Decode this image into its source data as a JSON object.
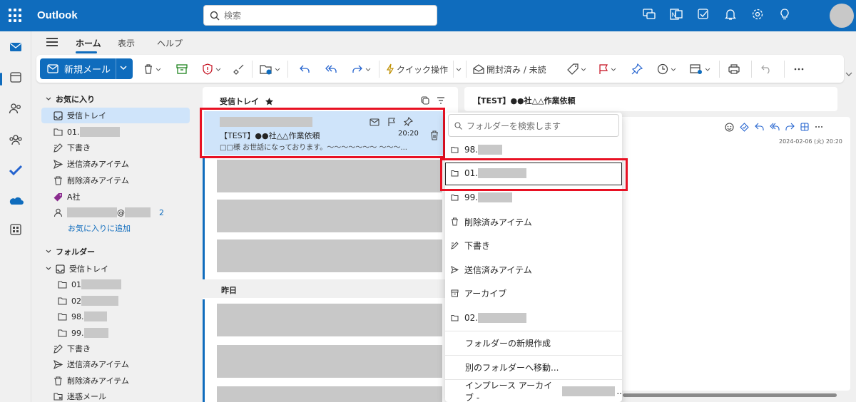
{
  "app": {
    "title": "Outlook"
  },
  "search": {
    "placeholder": "検索"
  },
  "tabs": [
    "ホーム",
    "表示",
    "ヘルプ"
  ],
  "ribbon": {
    "new_mail": "新規メール",
    "quick_steps": "クイック操作",
    "read_unread": "開封済み / 未読"
  },
  "folders": {
    "favorites_header": "お気に入り",
    "favorites": [
      {
        "label": "受信トレイ",
        "icon": "inbox-icon"
      },
      {
        "label": "01.",
        "icon": "folder-icon"
      },
      {
        "label": "下書き",
        "icon": "draft-icon"
      },
      {
        "label": "送信済みアイテム",
        "icon": "sent-icon"
      },
      {
        "label": "削除済みアイテム",
        "icon": "trash-icon"
      },
      {
        "label": "A社",
        "icon": "tag-icon"
      }
    ],
    "person_at": "@",
    "person_count": "2",
    "add_favorite": "お気に入りに追加",
    "folders_header": "フォルダー",
    "inbox": "受信トレイ",
    "subfolders": [
      "01",
      "02",
      "98.",
      "99."
    ],
    "others": [
      {
        "label": "下書き",
        "icon": "draft-icon"
      },
      {
        "label": "送信済みアイテム",
        "icon": "sent-icon"
      },
      {
        "label": "削除済みアイテム",
        "icon": "trash-icon"
      },
      {
        "label": "迷惑メール",
        "icon": "junk-icon"
      }
    ]
  },
  "list": {
    "header": "受信トレイ",
    "selected": {
      "subject": "【TEST】●●社△△作業依頼",
      "time": "20:20",
      "preview": "□□様 お世話になっております。～～～～～～～ ～～～..."
    },
    "yesterday": "昨日"
  },
  "reading": {
    "subject": "【TEST】●●社△△作業依頼",
    "date": "2024-02-06 (火) 20:20"
  },
  "move_menu": {
    "search_placeholder": "フォルダーを検索します",
    "items": [
      {
        "label": "98.",
        "icon": "folder-icon"
      },
      {
        "label": "01.",
        "icon": "folder-icon"
      },
      {
        "label": "99.",
        "icon": "folder-icon"
      },
      {
        "label": "削除済みアイテム",
        "icon": "trash-icon"
      },
      {
        "label": "下書き",
        "icon": "draft-icon"
      },
      {
        "label": "送信済みアイテム",
        "icon": "sent-icon"
      },
      {
        "label": "アーカイブ",
        "icon": "archive-icon"
      },
      {
        "label": "02.",
        "icon": "folder-icon"
      }
    ],
    "new_folder": "フォルダーの新規作成",
    "move_to_other": "別のフォルダーへ移動...",
    "inplace_archive": "インプレース アーカイブ -"
  },
  "colors": {
    "brand": "#0f6cbd",
    "selected_bg": "#cfe4fa",
    "highlight": "#e81123"
  }
}
